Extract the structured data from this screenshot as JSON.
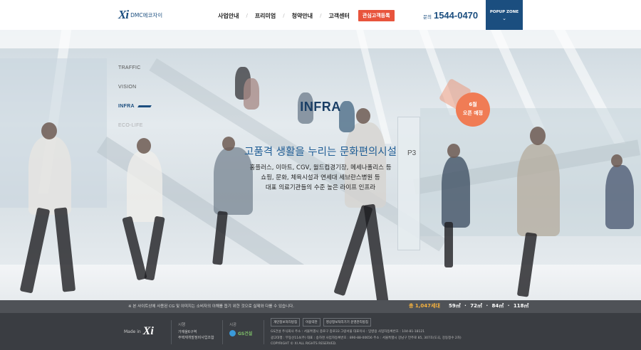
{
  "header": {
    "logo_mark": "Xi",
    "logo_text": "DMC에코자이",
    "nav": [
      "사업안내",
      "프리미엄",
      "청약안내",
      "고객센터"
    ],
    "cta": "관심고객등록",
    "phone_label": "문의",
    "phone_number": "1544-0470",
    "popup_label": "POPUP ZONE",
    "popup_icon": "chevron-down-icon"
  },
  "side_nav": {
    "items": [
      "TRAFFIC",
      "VISION",
      "INFRA",
      "ECO-LIFE"
    ],
    "active": "INFRA"
  },
  "badge": {
    "line1": "6월",
    "line2": "오픈 예정"
  },
  "hero": {
    "section_title": "INFRA",
    "headline": "고품격 생활을 누리는 문화편의시설",
    "desc_lines": [
      "홈플러스, 이마트, CGV, 월드컵경기장, 메세나폴리스 등",
      "쇼핑, 문화, 체육시설과 연세대 세브란스병원 등",
      "대표 의료기관들의 수준 높은 라이프 인프라"
    ],
    "sign": "P3"
  },
  "footer": {
    "notice": "※ 본 사이트상에 사용된 CG 및 이미지는 소비자의 이해를 돕기 위한 것으로 실제와 다를 수 있습니다.",
    "total": "총 1,047세대",
    "sizes": "59㎡ · 72㎡ · 84㎡ · 118㎡",
    "made_in_label": "Made in",
    "made_in_logo": "Xi",
    "col1_title": "시행",
    "col1_lines": [
      "가재울6구역",
      "주택재개발정비사업조합"
    ],
    "col2_title": "시공",
    "col2_name": "GS건설",
    "chips": [
      "개인정보처리방침",
      "이용약관",
      "영상정보처리기기 운영관리방침"
    ],
    "info_lines": [
      "GS건설 주식회사    주소 : 서울특별시 종로구 종로33 그랑서울    대표이사 : 임병용    사업자등록번호 : 104-81-18121",
      "광고대행 : 부동산114(주)    대표 : 송하천    사업자등록번호 : 890-88-00656    주소 : 서울특별시 강남구 언주로 85, 307호(도곡, 강동정수 2차)",
      "COPYRIGHT © XI ALL RIGHTS RESERVED."
    ]
  }
}
